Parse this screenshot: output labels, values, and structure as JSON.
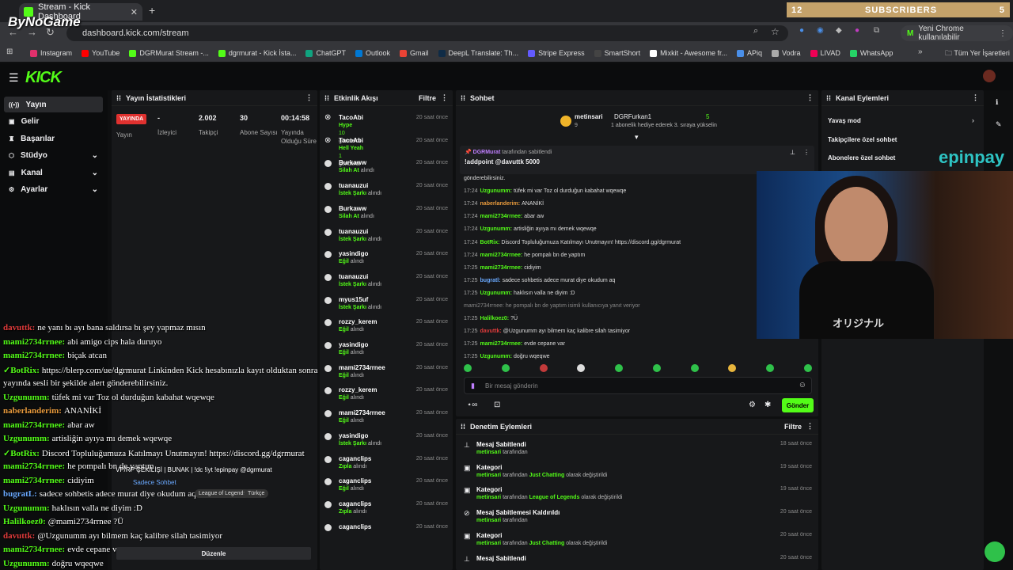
{
  "browser": {
    "tab_title": "Stream - Kick Dashboard",
    "url": "dashboard.kick.com/stream",
    "profile_label": "Yeni Chrome kullanılabilir",
    "profile_initial": "M",
    "watermark": "ByNoGame",
    "bookmarks": [
      "Instagram",
      "YouTube",
      "DGRMurat Stream -...",
      "dgrmurat - Kick İsta...",
      "ChatGPT",
      "Outlook",
      "Gmail",
      "DeepL Translate: Th...",
      "Stripe Express",
      "SmartShort",
      "Mixkit - Awesome fr...",
      "APiq",
      "Vodra",
      "LIVAD",
      "WhatsApp"
    ],
    "bookmarks_folder": "Tüm Yer İşaretleri",
    "subscribers_widget": {
      "left": "12",
      "label": "SUBSCRIBERS",
      "right": "5"
    }
  },
  "sidebar": {
    "items": [
      {
        "label": "Yayın",
        "icon": "broadcast-icon",
        "active": true
      },
      {
        "label": "Gelir",
        "icon": "wallet-icon"
      },
      {
        "label": "Başarılar",
        "icon": "trophy-icon"
      },
      {
        "label": "Stüdyo",
        "icon": "studio-icon",
        "expand": true
      },
      {
        "label": "Kanal",
        "icon": "channel-icon",
        "expand": true
      },
      {
        "label": "Ayarlar",
        "icon": "gear-icon",
        "expand": true
      }
    ]
  },
  "stats": {
    "title": "Yayın İstatistikleri",
    "live_badge": "YAYINDA",
    "items": [
      {
        "value": "",
        "label": "Yayın"
      },
      {
        "value": "-",
        "label": "İzleyici"
      },
      {
        "value": "2.002",
        "label": "Takipçi"
      },
      {
        "value": "30",
        "label": "Abone Sayısı"
      },
      {
        "value": "00:14:58",
        "label": "Yayında Olduğu Süre"
      }
    ]
  },
  "activity": {
    "title": "Etkinlik Akışı",
    "filter_label": "Filtre",
    "items": [
      {
        "name": "TacoAbi",
        "sub": "Hype",
        "extra": "10",
        "extra2": "gönderdi",
        "time": "20 saat önce"
      },
      {
        "name": "TacoAbi",
        "sub": "Hell Yeah",
        "extra": "1",
        "extra2": "gönderdi",
        "time": "20 saat önce"
      },
      {
        "name": "Burkaww",
        "sub": "Silah At",
        "extra2": "alındı",
        "time": "20 saat önce"
      },
      {
        "name": "tuanauzui",
        "sub": "İstek Şarkı",
        "extra2": "alındı",
        "time": "20 saat önce"
      },
      {
        "name": "Burkaww",
        "sub": "Silah At",
        "extra2": "alındı",
        "time": "20 saat önce"
      },
      {
        "name": "tuanauzui",
        "sub": "İstek Şarkı",
        "extra2": "alındı",
        "time": "20 saat önce"
      },
      {
        "name": "yasindigo",
        "sub": "Eğil",
        "extra2": "alındı",
        "time": "20 saat önce"
      },
      {
        "name": "tuanauzui",
        "sub": "İstek Şarkı",
        "extra2": "alındı",
        "time": "20 saat önce"
      },
      {
        "name": "myus15uf",
        "sub": "İstek Şarkı",
        "extra2": "alındı",
        "time": "20 saat önce"
      },
      {
        "name": "rozzy_kerem",
        "sub": "Eğil",
        "extra2": "alındı",
        "time": "20 saat önce"
      },
      {
        "name": "yasindigo",
        "sub": "Eğil",
        "extra2": "alındı",
        "time": "20 saat önce"
      },
      {
        "name": "mami2734rrnee",
        "sub": "Eğil",
        "extra2": "alındı",
        "time": "20 saat önce"
      },
      {
        "name": "rozzy_kerem",
        "sub": "Eğil",
        "extra2": "alındı",
        "time": "20 saat önce"
      },
      {
        "name": "mami2734rrnee",
        "sub": "Eğil",
        "extra2": "alındı",
        "time": "20 saat önce"
      },
      {
        "name": "yasindigo",
        "sub": "İstek Şarkı",
        "extra2": "alındı",
        "time": "20 saat önce"
      },
      {
        "name": "caganclips",
        "sub": "Zıpla",
        "extra2": "alındı",
        "time": "20 saat önce"
      },
      {
        "name": "caganclips",
        "sub": "Eğil",
        "extra2": "alındı",
        "time": "20 saat önce"
      },
      {
        "name": "caganclips",
        "sub": "Zıpla",
        "extra2": "alındı",
        "time": "20 saat önce"
      },
      {
        "name": "caganclips",
        "sub": "",
        "extra2": "",
        "time": "20 saat önce"
      }
    ]
  },
  "chat": {
    "title": "Sohbet",
    "top_user": "metinsari",
    "top_user_count": "9",
    "top_gift_user": "DGRFurkan1",
    "top_gift_count": "5",
    "top_gift_text": "1 abonelik hediye ederek 3. sıraya yükselin",
    "pinned_by": "DGRMurat",
    "pinned_suffix": "tarafından sabitlendi",
    "pinned_text": "!addpoint @davuttk 5000",
    "messages": [
      {
        "time": "",
        "user": "",
        "text": "gönderebilirsiniz.",
        "color": "#ddd"
      },
      {
        "time": "17:24",
        "user": "Uzgunumm:",
        "text": "tüfek mi var Toz ol durduğun kabahat wqewqe",
        "color": "#53fc18"
      },
      {
        "time": "17:24",
        "user": "naberlanderim:",
        "text": "ANANİKİ",
        "color": "#e89a3c"
      },
      {
        "time": "17:24",
        "user": "mami2734rrnee:",
        "text": "abar aw",
        "color": "#53fc18"
      },
      {
        "time": "17:24",
        "user": "Uzgunumm:",
        "text": "artisliğin ayıya mı demek wqewqe",
        "color": "#53fc18"
      },
      {
        "time": "17:24",
        "user": "BotRix:",
        "text": "Discord Topluluğumuza Katılmayı Unutmayın! https://discord.gg/dgrmurat",
        "color": "#53fc18"
      },
      {
        "time": "17:24",
        "user": "mami2734rrnee:",
        "text": "he pompalı bn de yaptım",
        "color": "#53fc18"
      },
      {
        "time": "17:25",
        "user": "mami2734rrnee:",
        "text": "cidiyim",
        "color": "#53fc18"
      },
      {
        "time": "17:25",
        "user": "bugratl:",
        "text": "sadece sohbetis adece murat diye okudum aq",
        "color": "#6aa9ff"
      },
      {
        "time": "17:25",
        "user": "Uzgunumm:",
        "text": "haklısın valla ne diyim :D",
        "color": "#53fc18"
      },
      {
        "time": "",
        "user": "",
        "text": "mami2734rrnee: he pompalı bn de yaptım isimli kullanıcıya yanıt veriyor",
        "color": "#888"
      },
      {
        "time": "17:25",
        "user": "Halilkoez0:",
        "text": "?Ü",
        "color": "#53fc18"
      },
      {
        "time": "17:25",
        "user": "davuttk:",
        "text": "@Uzgunumm ayı bilmem kaç kalibre silah tasimiyor",
        "color": "#e03b3b"
      },
      {
        "time": "17:25",
        "user": "mami2734rrnee:",
        "text": "evde cepane var",
        "color": "#53fc18"
      },
      {
        "time": "17:25",
        "user": "Uzgunumm:",
        "text": "doğru wqeqwe",
        "color": "#53fc18"
      }
    ],
    "input_placeholder": "Bir mesaj gönderin",
    "send_label": "Gönder"
  },
  "moderation": {
    "title": "Denetim Eylemleri",
    "filter_label": "Filtre",
    "items": [
      {
        "title": "Mesaj Sabitlendi",
        "user": "metinsari",
        "pre": "tarafından",
        "bold": "",
        "post": "",
        "time": "18 saat önce",
        "icon": "pin-icon"
      },
      {
        "title": "Kategori",
        "user": "metinsari",
        "pre": "tarafından",
        "bold": "Just Chatting",
        "post": "olarak değiştirildi",
        "time": "19 saat önce",
        "icon": "category-icon"
      },
      {
        "title": "Kategori",
        "user": "metinsari",
        "pre": "tarafından",
        "bold": "League of Legends",
        "post": "olarak değiştirildi",
        "time": "19 saat önce",
        "icon": "category-icon"
      },
      {
        "title": "Mesaj Sabitlemesi Kaldırıldı",
        "user": "metinsari",
        "pre": "tarafından",
        "bold": "",
        "post": "",
        "time": "20 saat önce",
        "icon": "unpin-icon"
      },
      {
        "title": "Kategori",
        "user": "metinsari",
        "pre": "tarafından",
        "bold": "Just Chatting",
        "post": "olarak değiştirildi",
        "time": "20 saat önce",
        "icon": "category-icon"
      },
      {
        "title": "Mesaj Sabitlendi",
        "user": "",
        "pre": "",
        "bold": "",
        "post": "",
        "time": "20 saat önce",
        "icon": "pin-icon"
      }
    ]
  },
  "channel": {
    "title": "Kanal Eylemleri",
    "items": [
      "Yavaş mod",
      "Takipçilere özel sohbet",
      "Abonelere özel sohbet"
    ]
  },
  "overlay": {
    "chat": [
      {
        "user": "davuttk:",
        "text": "ne yanı bı ayı bana saldırsa bı şey yapmaz mısın",
        "color": "#e03b3b"
      },
      {
        "user": "mami2734rrnee:",
        "text": "abi amigo cips hala duruyo",
        "color": "#53fc18"
      },
      {
        "user": "mami2734rrnee:",
        "text": "biçak atcan",
        "color": "#53fc18"
      },
      {
        "user": "✓BotRix:",
        "text": "https://blerp.com/ue/dgrmurat Linkinden Kick hesabınızla kayıt olduktan sonra",
        "color": "#53fc18"
      },
      {
        "user": "",
        "text": "yayında sesli bir şekilde alert gönderebilirsiniz.",
        "color": "#fff"
      },
      {
        "user": "Uzgunumm:",
        "text": "tüfek mi var Toz ol durduğun kabahat wqewqe",
        "color": "#53fc18"
      },
      {
        "user": "naberlanderim:",
        "text": "ANANİKİ",
        "color": "#e89a3c"
      },
      {
        "user": "mami2734rrnee:",
        "text": "abar aw",
        "color": "#53fc18"
      },
      {
        "user": "Uzgunumm:",
        "text": "artisliğin ayıya mı demek wqewqe",
        "color": "#53fc18"
      },
      {
        "user": "✓BotRix:",
        "text": "Discord Topluluğumuza Katılmayı Unutmayın! https://discord.gg/dgrmurat",
        "color": "#53fc18"
      },
      {
        "user": "mami2734rrnee:",
        "text": "he pompalı bn de yaptım",
        "color": "#53fc18"
      },
      {
        "user": "mami2734rrnee:",
        "text": "cidiyim",
        "color": "#53fc18"
      },
      {
        "user": "bugratL:",
        "text": "sadece sohbetis adece murat diye okudum aq",
        "color": "#6aa9ff"
      },
      {
        "user": "Uzgunumm:",
        "text": "haklısın valla ne diyim :D",
        "color": "#53fc18"
      },
      {
        "user": "Halilkoez0:",
        "text": "@mami2734rrnee ?Ü",
        "color": "#53fc18"
      },
      {
        "user": "davuttk:",
        "text": "@Uzgunumm ayı bilmem kaç kalibre silah tasimiyor",
        "color": "#e03b3b"
      },
      {
        "user": "mami2734rrnee:",
        "text": "evde cepane var",
        "color": "#53fc18"
      },
      {
        "user": "Uzgunumm:",
        "text": "doğru wqeqwe",
        "color": "#53fc18"
      }
    ],
    "giveaway": "VP/RP ÇEKİLİŞİ | BUNAK | !dc !iyt !epinpay @dgrmurat",
    "chip_sohbet": "Sadece Sohbet",
    "chip1": "League of Legends",
    "chip2": "Türkçe",
    "edit_label": "Düzenle",
    "epin_logo": "epinpay",
    "cam_text": "オリジナル"
  }
}
